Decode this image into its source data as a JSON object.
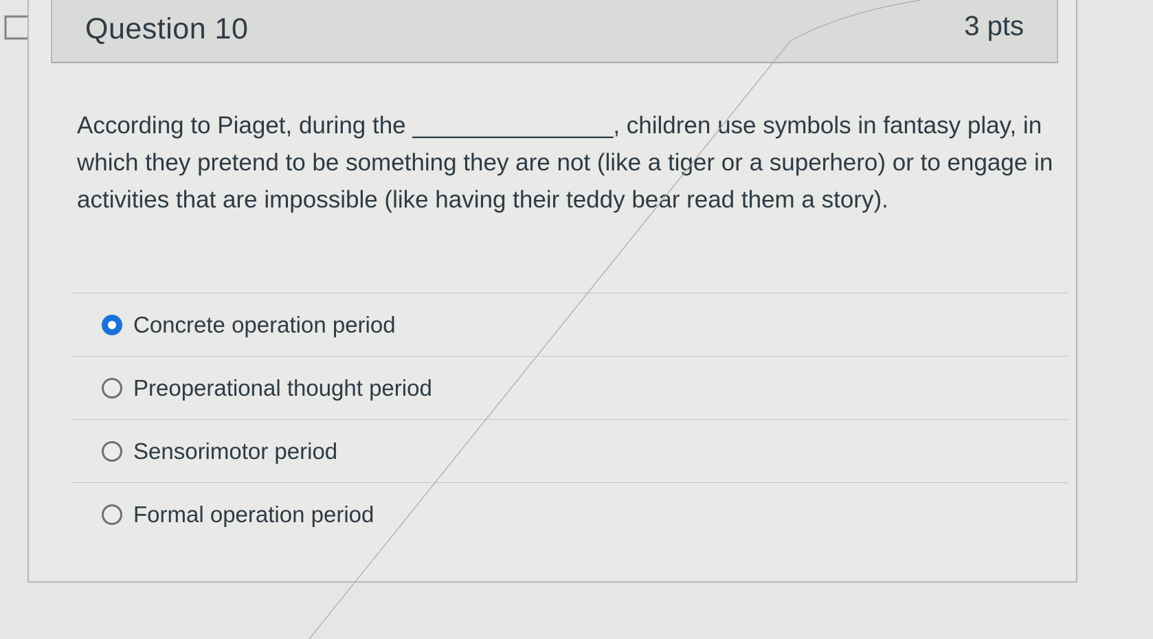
{
  "question": {
    "title": "Question 10",
    "points": "3 pts",
    "text": "According to Piaget, during the _______________, children use symbols in fantasy play, in which they pretend to be something they are not (like a tiger or a superhero) or to engage in activities that are impossible (like having their teddy bear read them a story)."
  },
  "answers": [
    {
      "label": "Concrete operation period",
      "selected": true
    },
    {
      "label": "Preoperational thought period",
      "selected": false
    },
    {
      "label": "Sensorimotor period",
      "selected": false
    },
    {
      "label": "Formal operation period",
      "selected": false
    }
  ],
  "colors": {
    "accent": "#1a73d8",
    "text": "#2d3b45",
    "background": "#e9e9e7",
    "header": "#dadad8"
  },
  "icons": {
    "bookmark": "bookmark-flag-icon",
    "radio_selected": "radio-selected-icon",
    "radio_unselected": "radio-unselected-icon"
  }
}
